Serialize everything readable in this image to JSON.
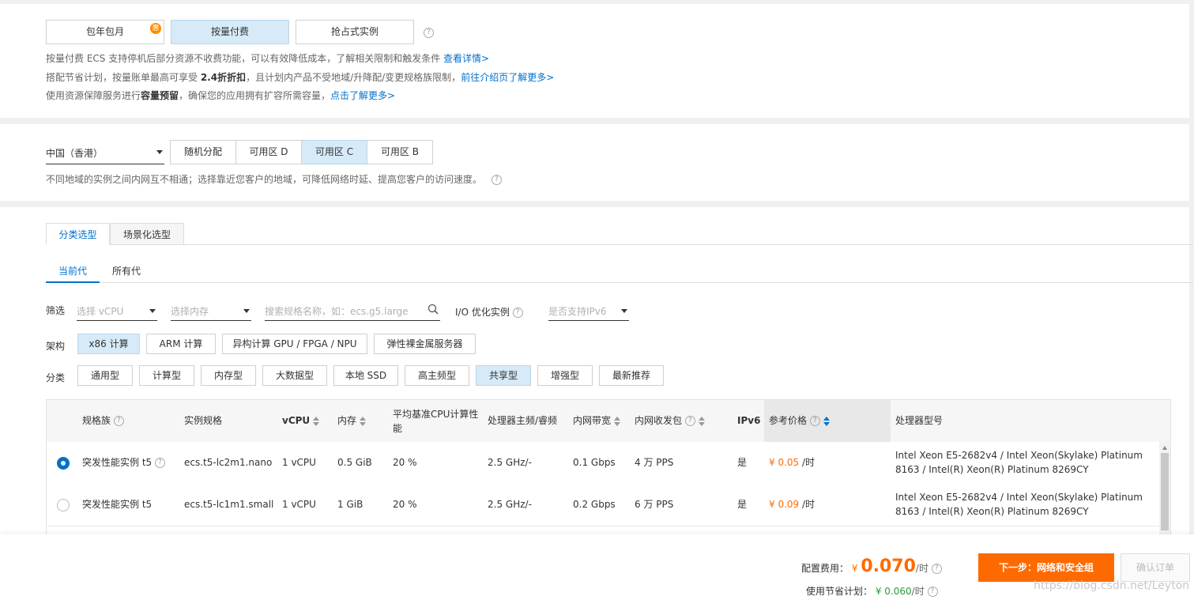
{
  "billing": {
    "options": [
      {
        "label": "包年包月",
        "badge": "惠",
        "selected": false
      },
      {
        "label": "按量付费",
        "selected": true
      },
      {
        "label": "抢占式实例",
        "selected": false
      }
    ],
    "notes": [
      {
        "text": "按量付费 ECS 支持停机后部分资源不收费功能，可以有效降低成本，了解相关限制和触发条件 ",
        "link": "查看详情>"
      },
      {
        "pre": "搭配节省计划，按量账单最高可享受 ",
        "bold": "2.4折折扣",
        "post": "，且计划内产品不受地域/升降配/变更规格族限制，",
        "link": "前往介绍页了解更多>"
      },
      {
        "pre": "使用资源保障服务进行",
        "bold": "容量预留",
        "post": "，确保您的应用拥有扩容所需容量，",
        "link": "点击了解更多>"
      }
    ]
  },
  "region": {
    "selected": "中国（香港）",
    "zones": [
      {
        "label": "随机分配",
        "selected": false
      },
      {
        "label": "可用区 D",
        "selected": false
      },
      {
        "label": "可用区 C",
        "selected": true
      },
      {
        "label": "可用区 B",
        "selected": false
      }
    ],
    "note": "不同地域的实例之间内网互不相通；选择靠近您客户的地域，可降低网络时延、提高您客户的访问速度。"
  },
  "tabs": {
    "main": [
      {
        "label": "分类选型",
        "active": true
      },
      {
        "label": "场景化选型",
        "active": false
      }
    ],
    "gen": [
      {
        "label": "当前代",
        "active": true
      },
      {
        "label": "所有代",
        "active": false
      }
    ]
  },
  "filter": {
    "label": "筛选",
    "vcpu_placeholder": "选择 vCPU",
    "mem_placeholder": "选择内存",
    "search_placeholder": "搜索规格名称，如：ecs.g5.large",
    "io_label": "I/O 优化实例",
    "ipv6_placeholder": "是否支持IPv6"
  },
  "arch": {
    "label": "架构",
    "options": [
      {
        "label": "x86 计算",
        "selected": true
      },
      {
        "label": "ARM 计算",
        "selected": false
      },
      {
        "label": "异构计算 GPU / FPGA / NPU",
        "selected": false
      },
      {
        "label": "弹性裸金属服务器",
        "selected": false
      }
    ]
  },
  "category": {
    "label": "分类",
    "options": [
      {
        "label": "通用型",
        "selected": false
      },
      {
        "label": "计算型",
        "selected": false
      },
      {
        "label": "内存型",
        "selected": false
      },
      {
        "label": "大数据型",
        "selected": false
      },
      {
        "label": "本地 SSD",
        "selected": false
      },
      {
        "label": "高主频型",
        "selected": false
      },
      {
        "label": "共享型",
        "selected": true
      },
      {
        "label": "增强型",
        "selected": false
      },
      {
        "label": "最新推荐",
        "selected": false
      }
    ]
  },
  "table": {
    "headers": {
      "family": "规格族",
      "spec": "实例规格",
      "vcpu": "vCPU",
      "mem": "内存",
      "cpu_baseline": "平均基准CPU计算性能",
      "freq": "处理器主频/睿频",
      "bandwidth": "内网带宽",
      "pps": "内网收发包",
      "ipv6": "IPv6",
      "price": "参考价格",
      "processor": "处理器型号"
    },
    "rows": [
      {
        "selected": true,
        "family": "突发性能实例 t5",
        "spec": "ecs.t5-lc2m1.nano",
        "vcpu": "1 vCPU",
        "mem": "0.5 GiB",
        "cpu": "20 %",
        "freq": "2.5 GHz/-",
        "bw": "0.1 Gbps",
        "pps": "4 万 PPS",
        "ipv6": "是",
        "price": "¥ 0.05",
        "unit": "/时",
        "processor": "Intel Xeon E5-2682v4 / Intel Xeon(Skylake) Platinum 8163 / Intel(R) Xeon(R) Platinum 8269CY"
      },
      {
        "selected": false,
        "family": "突发性能实例 t5",
        "spec": "ecs.t5-lc1m1.small",
        "vcpu": "1 vCPU",
        "mem": "1 GiB",
        "cpu": "20 %",
        "freq": "2.5 GHz/-",
        "bw": "0.2 Gbps",
        "pps": "6 万 PPS",
        "ipv6": "是",
        "price": "¥ 0.09",
        "unit": "/时",
        "processor": "Intel Xeon E5-2682v4 / Intel Xeon(Skylake) Platinum 8163 / Intel(R) Xeon(R) Platinum 8269CY"
      }
    ]
  },
  "footer": {
    "fee_label": "配置费用：",
    "currency": "¥",
    "fee": "0.070",
    "unit": "/时",
    "plan_label": "使用节省计划：",
    "plan_value": "¥ 0.060",
    "next_button": "下一步：网络和安全组",
    "confirm_button": "确认订单",
    "watermark": "https://blog.csdn.net/Leyton"
  },
  "colors": {
    "accent": "#0070cc",
    "orange": "#ff6a00",
    "selected_bg": "#d6eaf8"
  }
}
